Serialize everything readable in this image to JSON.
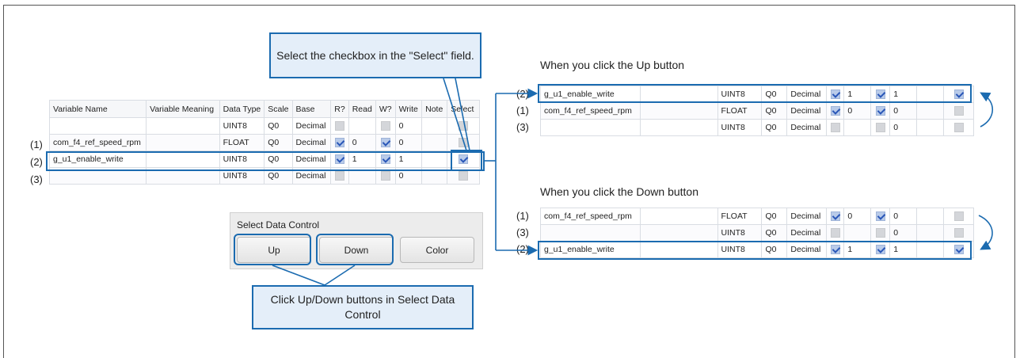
{
  "callouts": {
    "select": "Select the checkbox in the \"Select\" field.",
    "click": "Click Up/Down buttons in Select Data Control"
  },
  "headings": {
    "up": "When you click the Up button",
    "down": "When you click the Down button"
  },
  "main_table": {
    "headers": [
      "Variable Name",
      "Variable Meaning",
      "Data Type",
      "Scale",
      "Base",
      "R?",
      "Read",
      "W?",
      "Write",
      "Note",
      "Select"
    ],
    "rows": [
      {
        "label": "",
        "name": "",
        "type": "UINT8",
        "scale": "Q0",
        "base": "Decimal",
        "r": false,
        "read": "",
        "w": false,
        "write": "0",
        "select": false
      },
      {
        "label": "(1)",
        "name": "com_f4_ref_speed_rpm",
        "type": "FLOAT",
        "scale": "Q0",
        "base": "Decimal",
        "r": true,
        "read": "0",
        "w": true,
        "write": "0",
        "select": false
      },
      {
        "label": "(2)",
        "name": "g_u1_enable_write",
        "type": "UINT8",
        "scale": "Q0",
        "base": "Decimal",
        "r": true,
        "read": "1",
        "w": true,
        "write": "1",
        "select": true
      },
      {
        "label": "(3)",
        "name": "",
        "type": "UINT8",
        "scale": "Q0",
        "base": "Decimal",
        "r": false,
        "read": "",
        "w": false,
        "write": "0",
        "select": false
      }
    ]
  },
  "up_table": {
    "rows": [
      {
        "label": "(2)",
        "name": "g_u1_enable_write",
        "type": "UINT8",
        "scale": "Q0",
        "base": "Decimal",
        "r": true,
        "read": "1",
        "w": true,
        "write": "1",
        "select": true
      },
      {
        "label": "(1)",
        "name": "com_f4_ref_speed_rpm",
        "type": "FLOAT",
        "scale": "Q0",
        "base": "Decimal",
        "r": true,
        "read": "0",
        "w": true,
        "write": "0",
        "select": false
      },
      {
        "label": "(3)",
        "name": "",
        "type": "UINT8",
        "scale": "Q0",
        "base": "Decimal",
        "r": false,
        "read": "",
        "w": false,
        "write": "0",
        "select": false
      }
    ]
  },
  "down_table": {
    "rows": [
      {
        "label": "(1)",
        "name": "com_f4_ref_speed_rpm",
        "type": "FLOAT",
        "scale": "Q0",
        "base": "Decimal",
        "r": true,
        "read": "0",
        "w": true,
        "write": "0",
        "select": false
      },
      {
        "label": "(3)",
        "name": "",
        "type": "UINT8",
        "scale": "Q0",
        "base": "Decimal",
        "r": false,
        "read": "",
        "w": false,
        "write": "0",
        "select": false
      },
      {
        "label": "(2)",
        "name": "g_u1_enable_write",
        "type": "UINT8",
        "scale": "Q0",
        "base": "Decimal",
        "r": true,
        "read": "1",
        "w": true,
        "write": "1",
        "select": true
      }
    ]
  },
  "select_data_control": {
    "title": "Select Data Control",
    "up": "Up",
    "down": "Down",
    "color": "Color"
  },
  "colors": {
    "accent": "#1b6bb0",
    "callout_bg": "#e4eef9"
  }
}
